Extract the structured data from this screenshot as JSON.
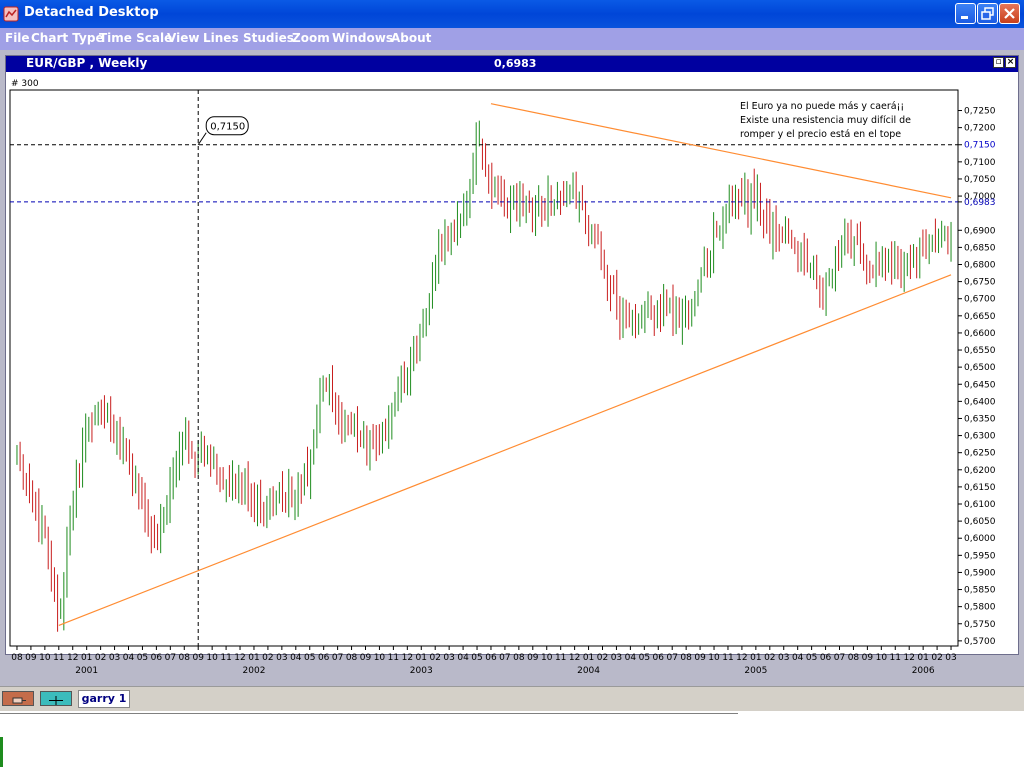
{
  "window": {
    "title": "Detached Desktop"
  },
  "menu": [
    "File",
    "Chart Type",
    "Time Scale",
    "View",
    "Lines",
    "Studies",
    "Zoom",
    "Windows",
    "About"
  ],
  "chart_window": {
    "title": "EUR/GBP , Weekly",
    "header_price": "0,6983",
    "count_label": "# 300"
  },
  "bottom": {
    "tab_label": "garry 1"
  },
  "colors": {
    "title_bar": "#0046d8",
    "menu_bar": "#a0a0e6",
    "chart_header": "#0000a0",
    "trend_line": "#ff8c32",
    "price_line": "#0000b4",
    "up_bar": "#1e8c1e",
    "down_bar": "#c81e1e"
  },
  "chart_data": {
    "type": "ohlc",
    "pair": "EUR/GBP",
    "timeframe": "Weekly",
    "y_ticks": [
      "0,7250",
      "0,7200",
      "0,7150",
      "0,7100",
      "0,7050",
      "0,7000",
      "0,6983",
      "0,6900",
      "0,6850",
      "0,6800",
      "0,6750",
      "0,6700",
      "0,6650",
      "0,6600",
      "0,6550",
      "0,6500",
      "0,6450",
      "0,6400",
      "0,6350",
      "0,6300",
      "0,6250",
      "0,6200",
      "0,6150",
      "0,6100",
      "0,6050",
      "0,6000",
      "0,5950",
      "0,5900",
      "0,5850",
      "0,5800",
      "0,5750",
      "0,5700"
    ],
    "ylim": [
      0.5685,
      0.731
    ],
    "x_month_labels": [
      "08",
      "09",
      "10",
      "11",
      "12",
      "01",
      "02",
      "03",
      "04",
      "05",
      "06",
      "07",
      "08",
      "09",
      "10",
      "11",
      "12",
      "01",
      "02",
      "03",
      "04",
      "05",
      "06",
      "07",
      "08",
      "09",
      "10",
      "11",
      "12",
      "01",
      "02",
      "03",
      "04",
      "05",
      "06",
      "07",
      "08",
      "09",
      "10",
      "11",
      "12",
      "01",
      "02",
      "03",
      "04",
      "05",
      "06",
      "07",
      "08",
      "09",
      "10",
      "11",
      "12",
      "01",
      "02",
      "03",
      "04",
      "05",
      "06",
      "07",
      "08",
      "09",
      "10",
      "11",
      "12",
      "01",
      "02",
      "03"
    ],
    "x_month_start": "2000-08",
    "x_year_labels": [
      {
        "label": "2001",
        "month": "2001-01"
      },
      {
        "label": "2002",
        "month": "2002-01"
      },
      {
        "label": "2003",
        "month": "2003-01"
      },
      {
        "label": "2004",
        "month": "2004-01"
      },
      {
        "label": "2005",
        "month": "2005-01"
      },
      {
        "label": "2006",
        "month": "2006-01"
      }
    ],
    "price_path": [
      [
        "2000-08",
        0.625
      ],
      [
        "2000-09",
        0.612
      ],
      [
        "2000-10",
        0.602
      ],
      [
        "2000-11",
        0.576
      ],
      [
        "2000-12",
        0.61
      ],
      [
        "2001-01",
        0.633
      ],
      [
        "2001-02",
        0.638
      ],
      [
        "2001-03",
        0.633
      ],
      [
        "2001-04",
        0.623
      ],
      [
        "2001-05",
        0.61
      ],
      [
        "2001-06",
        0.598
      ],
      [
        "2001-07",
        0.615
      ],
      [
        "2001-08",
        0.63
      ],
      [
        "2001-09",
        0.625
      ],
      [
        "2001-10",
        0.622
      ],
      [
        "2001-11",
        0.615
      ],
      [
        "2001-12",
        0.615
      ],
      [
        "2002-01",
        0.612
      ],
      [
        "2002-02",
        0.609
      ],
      [
        "2002-03",
        0.612
      ],
      [
        "2002-04",
        0.613
      ],
      [
        "2002-05",
        0.621
      ],
      [
        "2002-06",
        0.647
      ],
      [
        "2002-07",
        0.634
      ],
      [
        "2002-08",
        0.633
      ],
      [
        "2002-09",
        0.628
      ],
      [
        "2002-10",
        0.628
      ],
      [
        "2002-11",
        0.636
      ],
      [
        "2002-12",
        0.648
      ],
      [
        "2003-01",
        0.659
      ],
      [
        "2003-02",
        0.679
      ],
      [
        "2003-03",
        0.689
      ],
      [
        "2003-04",
        0.692
      ],
      [
        "2003-05",
        0.718
      ],
      [
        "2003-06",
        0.703
      ],
      [
        "2003-07",
        0.696
      ],
      [
        "2003-08",
        0.701
      ],
      [
        "2003-09",
        0.696
      ],
      [
        "2003-10",
        0.698
      ],
      [
        "2003-11",
        0.7
      ],
      [
        "2003-12",
        0.701
      ],
      [
        "2004-01",
        0.69
      ],
      [
        "2004-02",
        0.682
      ],
      [
        "2004-03",
        0.667
      ],
      [
        "2004-04",
        0.663
      ],
      [
        "2004-05",
        0.668
      ],
      [
        "2004-06",
        0.666
      ],
      [
        "2004-07",
        0.666
      ],
      [
        "2004-08",
        0.666
      ],
      [
        "2004-09",
        0.674
      ],
      [
        "2004-10",
        0.688
      ],
      [
        "2004-11",
        0.695
      ],
      [
        "2004-12",
        0.698
      ],
      [
        "2005-01",
        0.699
      ],
      [
        "2005-02",
        0.69
      ],
      [
        "2005-03",
        0.69
      ],
      [
        "2005-04",
        0.684
      ],
      [
        "2005-05",
        0.68
      ],
      [
        "2005-06",
        0.672
      ],
      [
        "2005-07",
        0.684
      ],
      [
        "2005-08",
        0.688
      ],
      [
        "2005-09",
        0.679
      ],
      [
        "2005-10",
        0.682
      ],
      [
        "2005-11",
        0.679
      ],
      [
        "2005-12",
        0.681
      ],
      [
        "2006-01",
        0.684
      ],
      [
        "2006-02",
        0.686
      ],
      [
        "2006-03",
        0.689
      ],
      [
        "2006-03",
        0.6983
      ]
    ],
    "price_line": {
      "value": 0.6983,
      "label": "0,6983"
    },
    "horizontal_line": {
      "value": 0.715,
      "label": "0,7150"
    },
    "vertical_line": {
      "date": "2001-09"
    },
    "callout": {
      "label": "0,7150",
      "date": "2001-09",
      "value": 0.715
    },
    "trendlines": [
      {
        "from": [
          "2000-11",
          0.5745
        ],
        "to": [
          "2006-03",
          0.677
        ]
      },
      {
        "from": [
          "2003-06",
          0.727
        ],
        "to": [
          "2006-03",
          0.6995
        ]
      }
    ],
    "annotation": [
      "El Euro ya no puede más y caerá¡¡",
      "Existe una resistencia muy difícil de",
      "romper y el precio está en el tope"
    ]
  }
}
